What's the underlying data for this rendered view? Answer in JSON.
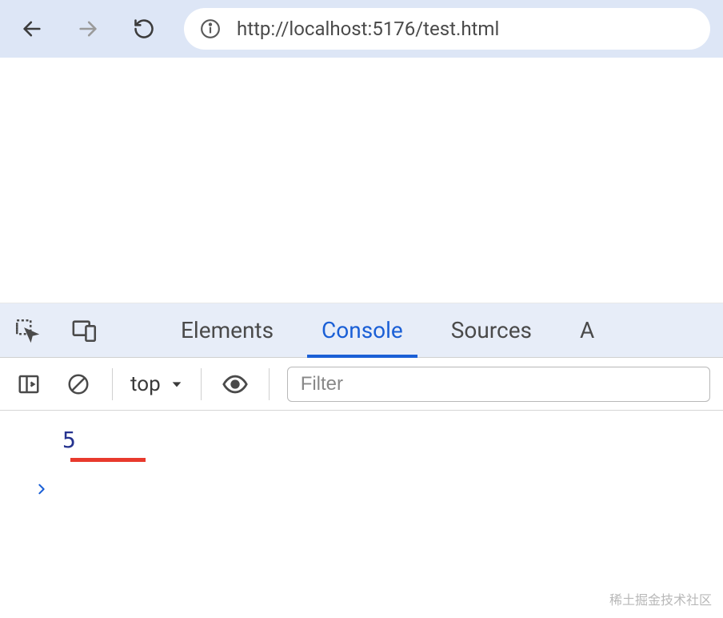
{
  "browser": {
    "url_display": "http://localhost:5176/test.html"
  },
  "devtools": {
    "tabs": {
      "elements": "Elements",
      "console": "Console",
      "sources": "Sources",
      "application_initial": "A"
    },
    "console": {
      "context_label": "top",
      "filter_placeholder": "Filter",
      "log_value": "5"
    }
  },
  "watermark": "稀土掘金技术社区"
}
